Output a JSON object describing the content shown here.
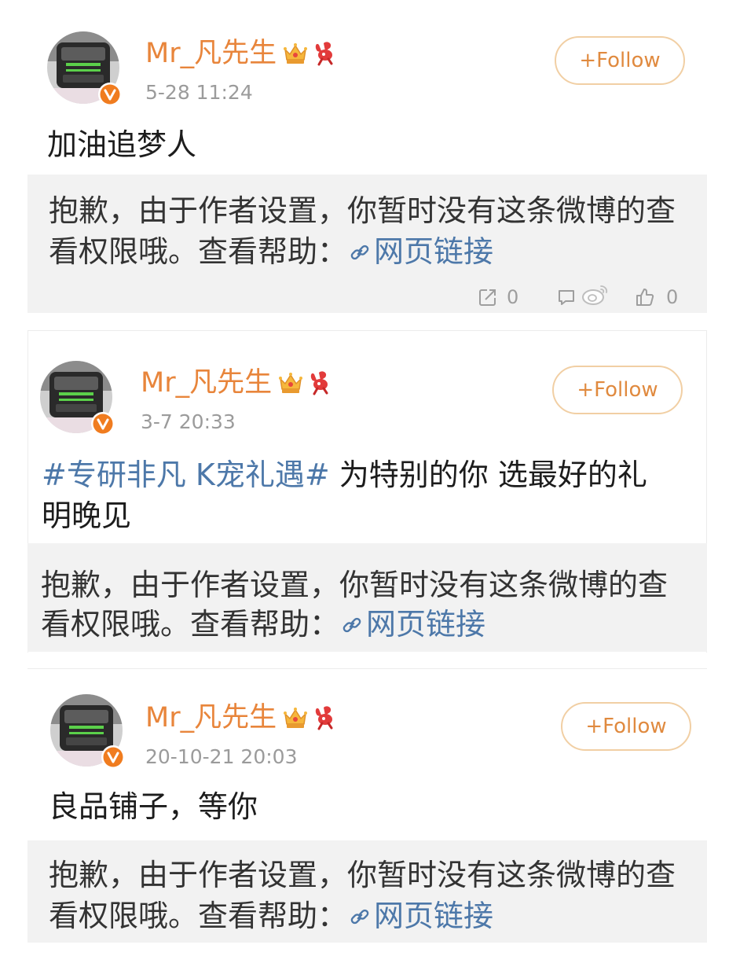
{
  "colors": {
    "username": "#e8853b",
    "follow_text": "#e08a3f",
    "follow_border": "#f1cfa4",
    "time": "#9b9b9b",
    "body_text": "#1c1c1c",
    "notice_text": "#333333",
    "link": "#4d78a9",
    "notice_bg": "#f2f2f2",
    "action_icon": "#9e9e9e",
    "verified": "#f07c1f"
  },
  "posts": [
    {
      "username": "Mr_凡先生",
      "badges": [
        "vip-crown-icon",
        "ribbon-badge-icon",
        "verified-badge-icon"
      ],
      "time": "5-28 11:24",
      "follow_label": "+Follow",
      "text_lines": [
        {
          "text": "加油追梦人"
        }
      ],
      "notice": {
        "line1": "抱歉，由于作者设置，你暂时没有这条微博的查",
        "line2": "看权限哦。查看帮助：",
        "link_icon": "link-icon",
        "link_text": "网页链接"
      },
      "actions": {
        "repost_icon": "repost-icon",
        "repost_count": "0",
        "comment_icon": "comment-icon",
        "like_icon": "like-icon",
        "like_count": "0"
      }
    },
    {
      "username": "Mr_凡先生",
      "badges": [
        "vip-crown-icon",
        "ribbon-badge-icon",
        "verified-badge-icon"
      ],
      "time": "3-7 20:33",
      "follow_label": "+Follow",
      "text_lines": [
        {
          "hashtag": "#专研非凡 K宠礼遇#",
          "text": " 为特别的你 选最好的礼"
        },
        {
          "text": "明晚见"
        }
      ],
      "notice": {
        "line1": "抱歉，由于作者设置，你暂时没有这条微博的查",
        "line2": "看权限哦。查看帮助：",
        "link_icon": "link-icon",
        "link_text": "网页链接"
      }
    },
    {
      "username": "Mr_凡先生",
      "badges": [
        "vip-crown-icon",
        "ribbon-badge-icon",
        "verified-badge-icon"
      ],
      "time": "20-10-21 20:03",
      "follow_label": "+Follow",
      "text_lines": [
        {
          "text": "良品铺子，等你"
        }
      ],
      "notice": {
        "line1": "抱歉，由于作者设置，你暂时没有这条微博的查",
        "line2": "看权限哦。查看帮助：",
        "link_icon": "link-icon",
        "link_text": "网页链接"
      }
    }
  ],
  "watermark": {
    "icon": "weibo-logo-icon"
  }
}
